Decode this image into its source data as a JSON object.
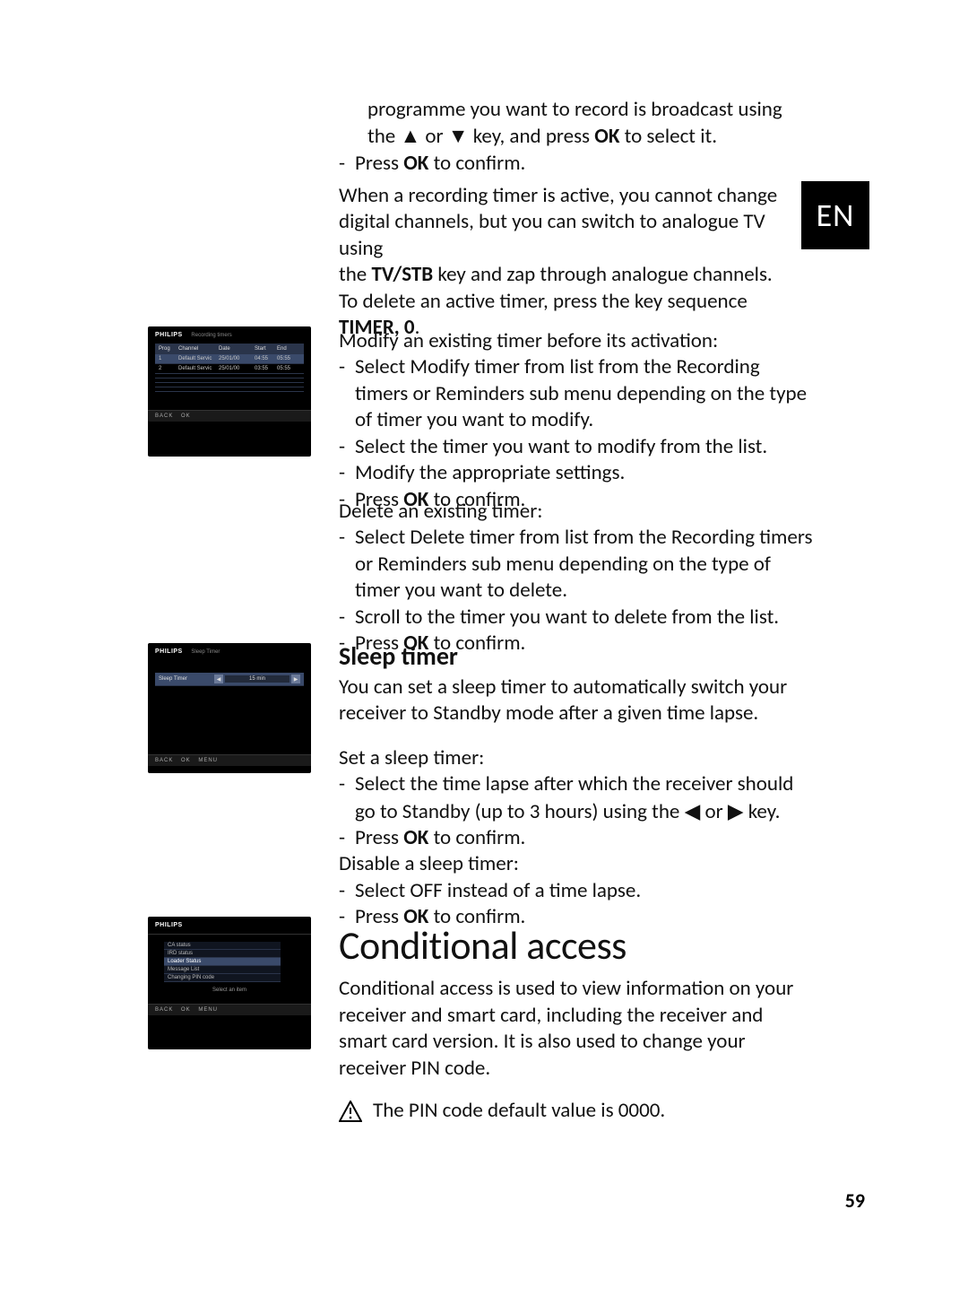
{
  "lang_tag": "EN",
  "page_number": "59",
  "shot_brand": "PHILIPS",
  "shot1": {
    "title": "Recording timers",
    "headers": {
      "prog": "Prog",
      "channel": "Channel",
      "date": "Date",
      "start": "Start",
      "end": "End"
    },
    "rows": [
      {
        "prog": "1",
        "channel": "Default Servic",
        "date": "25/01/00",
        "start": "04:55",
        "end": "05:55"
      },
      {
        "prog": "2",
        "channel": "Default Servic",
        "date": "25/01/00",
        "start": "03:55",
        "end": "05:55"
      }
    ],
    "buttons": "BACK   OK"
  },
  "shot2": {
    "title": "Sleep Timer",
    "row_label": "Sleep Timer",
    "row_value": "15 min",
    "left_arrow": "◀",
    "right_arrow": "▶",
    "buttons": "BACK   OK   MENU"
  },
  "shot3": {
    "title": "",
    "items": [
      "CA status",
      "IRD status",
      "Loader Status",
      "Message List",
      "Changing PIN code"
    ],
    "hint": "Select an item",
    "buttons": "BACK   OK   MENU"
  },
  "block_top": {
    "l1a": "programme you want to record is broadcast using",
    "l1b_pre": "the ",
    "l1b_up": "▲",
    "l1b_mid": " or ",
    "l1b_down": "▼",
    "l1b_post": " key, and press ",
    "l1b_ok": "OK",
    "l1b_end": " to select it.",
    "l2_pre": "Press ",
    "l2_ok": "OK",
    "l2_post": " to confirm."
  },
  "note": {
    "l1": "When a recording timer is active, you cannot change",
    "l2": "digital channels, but you can switch to analogue TV using",
    "l3_pre": "the ",
    "l3_kw": "TV/STB",
    "l3_post": " key and zap through analogue channels.",
    "l4": "To delete an active timer, press the key sequence",
    "l5_kw": "TIMER, 0",
    "l5_post": "."
  },
  "modify": {
    "intro": "Modify an existing timer before its activation:",
    "b1": "Select Modify timer from list from the Recording timers or Reminders sub menu depending on the type of timer you want to modify.",
    "b2": "Select the timer you want to modify from the list.",
    "b3": "Modify the appropriate settings.",
    "b4_pre": "Press ",
    "b4_ok": "OK",
    "b4_post": " to confirm."
  },
  "delete": {
    "intro": "Delete an existing timer:",
    "b1": "Select Delete timer from list from the Recording timers or Reminders sub menu depending on the type of timer you want to delete.",
    "b2": "Scroll to the timer you want to delete from the list.",
    "b3_pre": "Press ",
    "b3_ok": "OK",
    "b3_post": " to confirm."
  },
  "sleep": {
    "title": "Sleep timer",
    "intro1": "You can set a sleep timer to automatically switch your",
    "intro2": "receiver to Standby mode after a given time lapse.",
    "set": "Set a sleep timer:",
    "b1_pre": "Select the time lapse after which the receiver should go to Standby (up to 3 hours) using the ",
    "b1_left": "◀",
    "b1_mid": " or ",
    "b1_right": "▶",
    "b1_post": "  key.",
    "b2_pre": "Press ",
    "b2_ok": "OK",
    "b2_post": " to confirm.",
    "disable": "Disable a sleep timer:",
    "d1": "Select OFF instead of a time lapse.",
    "d2_pre": "Press ",
    "d2_ok": "OK",
    "d2_post": " to confirm."
  },
  "cond": {
    "title": "Conditional access",
    "p1": "Conditional access is used to view information on your receiver and smart card, including the receiver and smart card version. It is also used to change your receiver PIN code.",
    "warn": "The PIN code default value is 0000."
  }
}
